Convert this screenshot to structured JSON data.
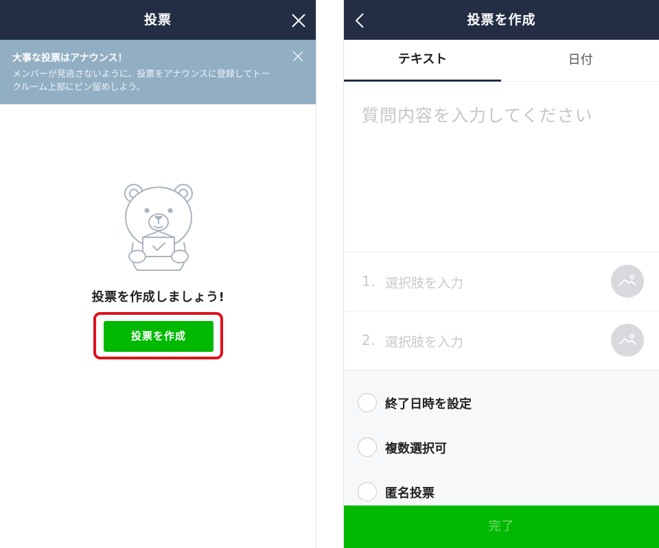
{
  "left_screen": {
    "header": {
      "title": "投票"
    },
    "banner": {
      "title": "大事な投票はアナウンス！",
      "text": "メンバーが見逃さないように、投票をアナウンスに登録してトークルーム上部にピン留めしよう。"
    },
    "illustration": {
      "icon": "bear-holding-ballot-box"
    },
    "prompt": "投票を作成しましょう!",
    "create_button_label": "投票を作成",
    "colors": {
      "header": "#232e45",
      "banner": "#91aec3",
      "button": "#00b900",
      "highlight": "#e0101a"
    }
  },
  "right_screen": {
    "header": {
      "title": "投票を作成"
    },
    "tabs": [
      {
        "label": "テキスト",
        "active": true
      },
      {
        "label": "日付",
        "active": false
      }
    ],
    "question_placeholder": "質問内容を入力してください",
    "options": [
      {
        "number": "1.",
        "placeholder": "選択肢を入力"
      },
      {
        "number": "2.",
        "placeholder": "選択肢を入力"
      }
    ],
    "settings": [
      {
        "label": "終了日時を設定",
        "checked": false
      },
      {
        "label": "複数選択可",
        "checked": false
      },
      {
        "label": "匿名投票",
        "checked": false
      }
    ],
    "done_label": "完了"
  }
}
